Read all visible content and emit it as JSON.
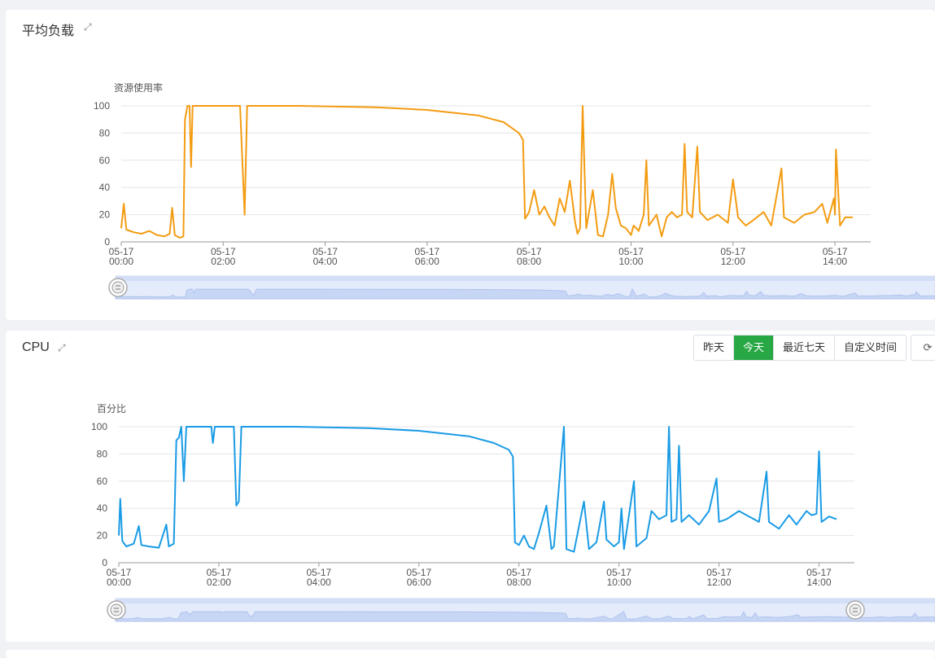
{
  "colors": {
    "load": "#f39c12",
    "cpu": "#1a9be5",
    "active_button": "#28a745"
  },
  "toolbar": {
    "buttons": [
      "昨天",
      "今天",
      "最近七天",
      "自定义时间"
    ],
    "active": "今天",
    "refresh_icon": "refresh-icon"
  },
  "chart_data": [
    {
      "type": "line",
      "title": "平均负载",
      "ylabel": "资源使用率",
      "xlabel": "",
      "ylim": [
        0,
        100
      ],
      "yticks": [
        0,
        20,
        40,
        60,
        80,
        100
      ],
      "xticks": [
        "05-17\n00:00",
        "05-17\n02:00",
        "05-17\n04:00",
        "05-17\n06:00",
        "05-17\n08:00",
        "05-17\n10:00",
        "05-17\n12:00",
        "05-17\n14:00"
      ],
      "grid": true,
      "x_unit": "hours since 05-17 00:00",
      "series": [
        {
          "values": [
            [
              0.0,
              10
            ],
            [
              0.05,
              28
            ],
            [
              0.1,
              9
            ],
            [
              0.25,
              7
            ],
            [
              0.4,
              6
            ],
            [
              0.55,
              8
            ],
            [
              0.7,
              5
            ],
            [
              0.85,
              4
            ],
            [
              0.95,
              6
            ],
            [
              1.0,
              25
            ],
            [
              1.05,
              5
            ],
            [
              1.15,
              3
            ],
            [
              1.22,
              4
            ],
            [
              1.25,
              90
            ],
            [
              1.3,
              100
            ],
            [
              1.34,
              100
            ],
            [
              1.37,
              55
            ],
            [
              1.4,
              100
            ],
            [
              1.5,
              100
            ],
            [
              2.2,
              100
            ],
            [
              2.33,
              100
            ],
            [
              2.42,
              20
            ],
            [
              2.47,
              100
            ],
            [
              3.5,
              100
            ],
            [
              5.0,
              99
            ],
            [
              6.0,
              97
            ],
            [
              7.0,
              93
            ],
            [
              7.5,
              88
            ],
            [
              7.8,
              80
            ],
            [
              7.88,
              75
            ],
            [
              7.92,
              17
            ],
            [
              8.0,
              22
            ],
            [
              8.1,
              38
            ],
            [
              8.2,
              20
            ],
            [
              8.3,
              26
            ],
            [
              8.4,
              18
            ],
            [
              8.5,
              12
            ],
            [
              8.6,
              32
            ],
            [
              8.7,
              22
            ],
            [
              8.8,
              45
            ],
            [
              8.9,
              15
            ],
            [
              8.95,
              6
            ],
            [
              9.0,
              10
            ],
            [
              9.05,
              100
            ],
            [
              9.12,
              10
            ],
            [
              9.25,
              38
            ],
            [
              9.35,
              5
            ],
            [
              9.45,
              4
            ],
            [
              9.55,
              20
            ],
            [
              9.63,
              50
            ],
            [
              9.7,
              25
            ],
            [
              9.8,
              12
            ],
            [
              9.9,
              10
            ],
            [
              10.0,
              5
            ],
            [
              10.05,
              12
            ],
            [
              10.15,
              8
            ],
            [
              10.25,
              20
            ],
            [
              10.3,
              60
            ],
            [
              10.35,
              12
            ],
            [
              10.5,
              20
            ],
            [
              10.6,
              4
            ],
            [
              10.7,
              18
            ],
            [
              10.8,
              22
            ],
            [
              10.9,
              18
            ],
            [
              11.0,
              20
            ],
            [
              11.05,
              72
            ],
            [
              11.1,
              22
            ],
            [
              11.2,
              18
            ],
            [
              11.3,
              70
            ],
            [
              11.35,
              22
            ],
            [
              11.5,
              16
            ],
            [
              11.7,
              20
            ],
            [
              11.9,
              14
            ],
            [
              12.0,
              46
            ],
            [
              12.1,
              18
            ],
            [
              12.25,
              12
            ],
            [
              12.4,
              16
            ],
            [
              12.6,
              22
            ],
            [
              12.75,
              12
            ],
            [
              12.95,
              54
            ],
            [
              13.0,
              18
            ],
            [
              13.2,
              14
            ],
            [
              13.4,
              20
            ],
            [
              13.6,
              22
            ],
            [
              13.75,
              28
            ],
            [
              13.85,
              14
            ],
            [
              13.98,
              32
            ],
            [
              14.0,
              20
            ],
            [
              14.02,
              68
            ],
            [
              14.1,
              12
            ],
            [
              14.2,
              18
            ],
            [
              14.35,
              18
            ]
          ]
        }
      ]
    },
    {
      "type": "line",
      "title": "CPU",
      "ylabel": "百分比",
      "xlabel": "",
      "ylim": [
        0,
        100
      ],
      "yticks": [
        0,
        20,
        40,
        60,
        80,
        100
      ],
      "xticks": [
        "05-17\n00:00",
        "05-17\n02:00",
        "05-17\n04:00",
        "05-17\n06:00",
        "05-17\n08:00",
        "05-17\n10:00",
        "05-17\n12:00",
        "05-17\n14:00"
      ],
      "grid": true,
      "x_unit": "hours since 05-17 00:00",
      "series": [
        {
          "values": [
            [
              0.0,
              20
            ],
            [
              0.03,
              47
            ],
            [
              0.07,
              16
            ],
            [
              0.15,
              12
            ],
            [
              0.3,
              14
            ],
            [
              0.4,
              27
            ],
            [
              0.45,
              13
            ],
            [
              0.6,
              12
            ],
            [
              0.8,
              11
            ],
            [
              0.95,
              28
            ],
            [
              1.0,
              12
            ],
            [
              1.1,
              14
            ],
            [
              1.15,
              90
            ],
            [
              1.2,
              92
            ],
            [
              1.25,
              100
            ],
            [
              1.3,
              60
            ],
            [
              1.35,
              100
            ],
            [
              1.5,
              100
            ],
            [
              1.85,
              100
            ],
            [
              1.88,
              88
            ],
            [
              1.92,
              100
            ],
            [
              2.3,
              100
            ],
            [
              2.35,
              42
            ],
            [
              2.4,
              45
            ],
            [
              2.45,
              100
            ],
            [
              3.5,
              100
            ],
            [
              5.0,
              99
            ],
            [
              6.0,
              97
            ],
            [
              7.0,
              93
            ],
            [
              7.5,
              88
            ],
            [
              7.8,
              83
            ],
            [
              7.88,
              78
            ],
            [
              7.92,
              15
            ],
            [
              8.0,
              13
            ],
            [
              8.1,
              20
            ],
            [
              8.2,
              12
            ],
            [
              8.3,
              10
            ],
            [
              8.4,
              22
            ],
            [
              8.55,
              42
            ],
            [
              8.65,
              10
            ],
            [
              8.7,
              12
            ],
            [
              8.9,
              100
            ],
            [
              8.95,
              10
            ],
            [
              9.1,
              8
            ],
            [
              9.3,
              45
            ],
            [
              9.4,
              10
            ],
            [
              9.55,
              15
            ],
            [
              9.7,
              45
            ],
            [
              9.75,
              17
            ],
            [
              9.9,
              12
            ],
            [
              10.0,
              15
            ],
            [
              10.05,
              40
            ],
            [
              10.1,
              10
            ],
            [
              10.3,
              60
            ],
            [
              10.35,
              12
            ],
            [
              10.55,
              18
            ],
            [
              10.65,
              38
            ],
            [
              10.8,
              32
            ],
            [
              10.95,
              35
            ],
            [
              11.0,
              100
            ],
            [
              11.05,
              30
            ],
            [
              11.15,
              32
            ],
            [
              11.2,
              86
            ],
            [
              11.25,
              30
            ],
            [
              11.4,
              35
            ],
            [
              11.6,
              28
            ],
            [
              11.8,
              38
            ],
            [
              11.95,
              62
            ],
            [
              12.0,
              30
            ],
            [
              12.15,
              32
            ],
            [
              12.4,
              38
            ],
            [
              12.6,
              34
            ],
            [
              12.8,
              30
            ],
            [
              12.95,
              67
            ],
            [
              13.0,
              30
            ],
            [
              13.2,
              25
            ],
            [
              13.4,
              35
            ],
            [
              13.55,
              28
            ],
            [
              13.75,
              38
            ],
            [
              13.85,
              35
            ],
            [
              13.95,
              36
            ],
            [
              14.0,
              82
            ],
            [
              14.05,
              30
            ],
            [
              14.2,
              34
            ],
            [
              14.35,
              32
            ]
          ]
        }
      ]
    }
  ]
}
